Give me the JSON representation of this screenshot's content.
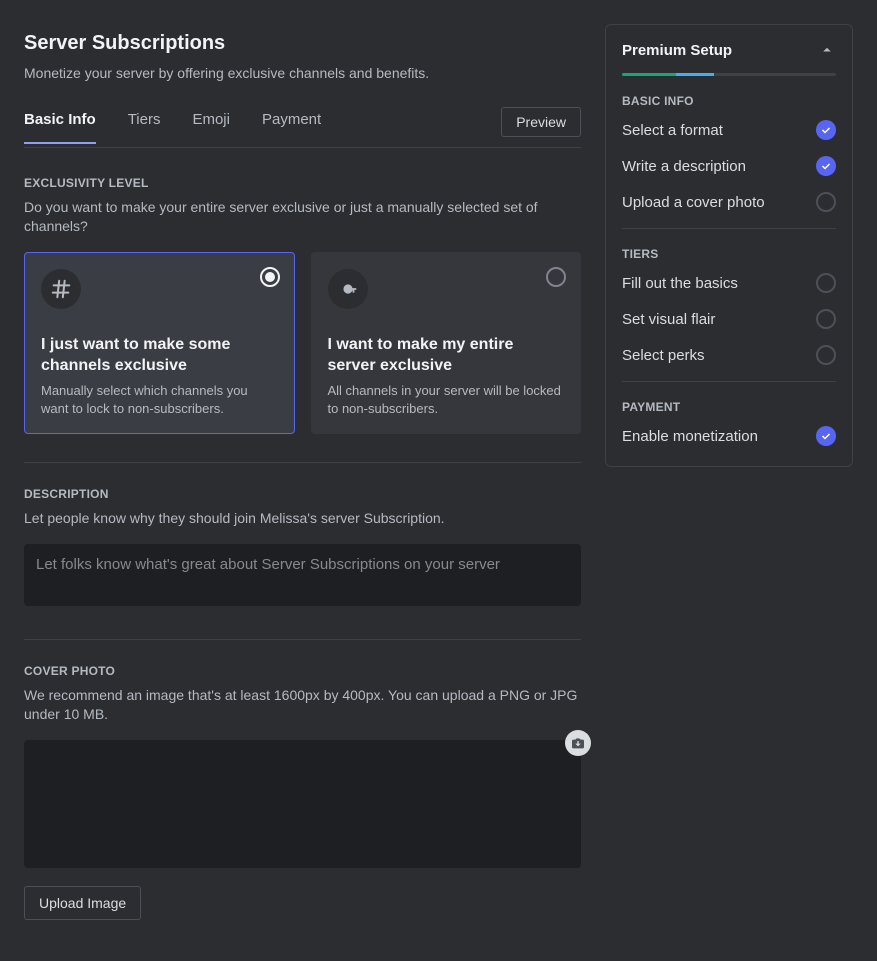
{
  "header": {
    "title": "Server Subscriptions",
    "subtitle": "Monetize your server by offering exclusive channels and benefits.",
    "preview_label": "Preview"
  },
  "tabs": [
    {
      "label": "Basic Info",
      "active": true
    },
    {
      "label": "Tiers"
    },
    {
      "label": "Emoji"
    },
    {
      "label": "Payment"
    }
  ],
  "exclusivity": {
    "heading": "EXCLUSIVITY LEVEL",
    "desc": "Do you want to make your entire server exclusive or just a manually selected set of channels?",
    "options": [
      {
        "title": "I just want to make some channels exclusive",
        "body": "Manually select which channels you want to lock to non-subscribers.",
        "selected": true
      },
      {
        "title": "I want to make my entire server exclusive",
        "body": "All channels in your server will be locked to non-subscribers."
      }
    ]
  },
  "description": {
    "heading": "DESCRIPTION",
    "desc": "Let people know why they should join Melissa's server Subscription.",
    "placeholder": "Let folks know what's great about Server Subscriptions on your server"
  },
  "cover": {
    "heading": "COVER PHOTO",
    "desc": "We recommend an image that's at least 1600px by 400px. You can upload a PNG or JPG under 10 MB.",
    "button_label": "Upload Image"
  },
  "setup": {
    "title": "Premium Setup",
    "sections": [
      {
        "label": "BASIC INFO",
        "items": [
          {
            "text": "Select a format",
            "done": true
          },
          {
            "text": "Write a description",
            "done": true
          },
          {
            "text": "Upload a cover photo",
            "done": false
          }
        ]
      },
      {
        "label": "TIERS",
        "items": [
          {
            "text": "Fill out the basics",
            "done": false
          },
          {
            "text": "Set visual flair",
            "done": false
          },
          {
            "text": "Select perks",
            "done": false
          }
        ]
      },
      {
        "label": "PAYMENT",
        "items": [
          {
            "text": "Enable monetization",
            "done": true
          }
        ]
      }
    ]
  }
}
